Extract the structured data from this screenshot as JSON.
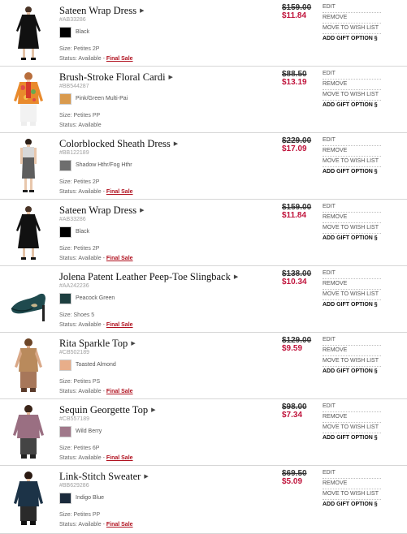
{
  "actions": {
    "edit": "EDIT",
    "remove": "REMOVE",
    "wishlist": "MOVE TO WISH LIST",
    "gift": "ADD GIFT OPTION §"
  },
  "items": [
    {
      "name": "Sateen Wrap Dress",
      "sku": "#AB33286",
      "color": "Black",
      "swatch_color": "#000000",
      "size": "Size: Petites 2P",
      "status": "Status: Available - ",
      "final_sale": "Final Sale",
      "original_price": "$159.00",
      "sale_price": "$11.84",
      "image": "black-wrap-dress"
    },
    {
      "name": "Brush-Stroke Floral Cardi",
      "sku": "#BB544287",
      "color": "Pink/Green Multi-Pai",
      "swatch_color": "#d99a4e",
      "size": "Size: Petites PP",
      "status": "Status: Available",
      "final_sale": "",
      "original_price": "$88.50",
      "sale_price": "$13.19",
      "image": "floral-cardigan"
    },
    {
      "name": "Colorblocked Sheath Dress",
      "sku": "#BB122189",
      "color": "Shadow Hthr/Fog Hthr",
      "swatch_color": "#6e6e6e",
      "size": "Size: Petites 2P",
      "status": "Status: Available - ",
      "final_sale": "Final Sale",
      "original_price": "$229.00",
      "sale_price": "$17.09",
      "image": "colorblock-sheath"
    },
    {
      "name": "Sateen Wrap Dress",
      "sku": "#AB33286",
      "color": "Black",
      "swatch_color": "#000000",
      "size": "Size: Petites 2P",
      "status": "Status: Available - ",
      "final_sale": "Final Sale",
      "original_price": "$159.00",
      "sale_price": "$11.84",
      "image": "black-wrap-dress"
    },
    {
      "name": "Jolena Patent Leather Peep-Toe Slingback",
      "sku": "#AA242236",
      "color": "Peacock Green",
      "swatch_color": "#1d3f40",
      "size": "Size: Shoes 5",
      "status": "Status: Available - ",
      "final_sale": "Final Sale",
      "original_price": "$138.00",
      "sale_price": "$10.34",
      "image": "peep-toe-shoe"
    },
    {
      "name": "Rita Sparkle Top",
      "sku": "#CB502189",
      "color": "Toasted Almond",
      "swatch_color": "#e8ae8a",
      "size": "Size: Petites PS",
      "status": "Status: Available - ",
      "final_sale": "Final Sale",
      "original_price": "$129.00",
      "sale_price": "$9.59",
      "image": "sparkle-top"
    },
    {
      "name": "Sequin Georgette Top",
      "sku": "#CB557189",
      "color": "Wild Berry",
      "swatch_color": "#a0788a",
      "size": "Size: Petites 6P",
      "status": "Status: Available - ",
      "final_sale": "Final Sale",
      "original_price": "$98.00",
      "sale_price": "$7.34",
      "image": "georgette-top"
    },
    {
      "name": "Link-Stitch Sweater",
      "sku": "#BB629286",
      "color": "Indigo Blue",
      "swatch_color": "#1a2a3c",
      "size": "Size: Petites PP",
      "status": "Status: Available - ",
      "final_sale": "Final Sale",
      "original_price": "$69.50",
      "sale_price": "$5.09",
      "image": "link-stitch-sweater"
    }
  ]
}
